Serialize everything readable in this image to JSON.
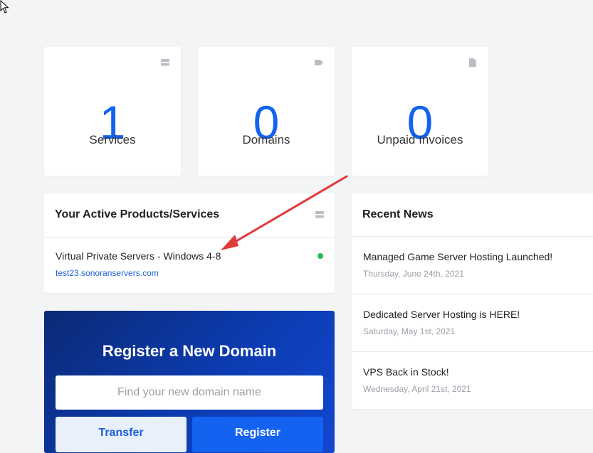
{
  "stats": [
    {
      "value": "1",
      "label": "Services",
      "icon": "server-icon"
    },
    {
      "value": "0",
      "label": "Domains",
      "icon": "tag-icon"
    },
    {
      "value": "0",
      "label": "Unpaid Invoices",
      "icon": "file-icon"
    }
  ],
  "products": {
    "title": "Your Active Products/Services",
    "items": [
      {
        "name": "Virtual Private Servers - Windows 4-8",
        "domain": "test23.sonoranservers.com",
        "status_color": "#1fc05a"
      }
    ]
  },
  "news": {
    "title": "Recent News",
    "items": [
      {
        "title": "Managed Game Server Hosting Launched!",
        "date": "Thursday, June 24th, 2021"
      },
      {
        "title": "Dedicated Server Hosting is HERE!",
        "date": "Saturday, May 1st, 2021"
      },
      {
        "title": "VPS Back in Stock!",
        "date": "Wednesday, April 21st, 2021"
      }
    ]
  },
  "domain_search": {
    "title": "Register a New Domain",
    "placeholder": "Find your new domain name",
    "transfer_label": "Transfer",
    "register_label": "Register"
  },
  "colors": {
    "accent": "#1363f0",
    "annotation_arrow": "#e03a3a"
  }
}
